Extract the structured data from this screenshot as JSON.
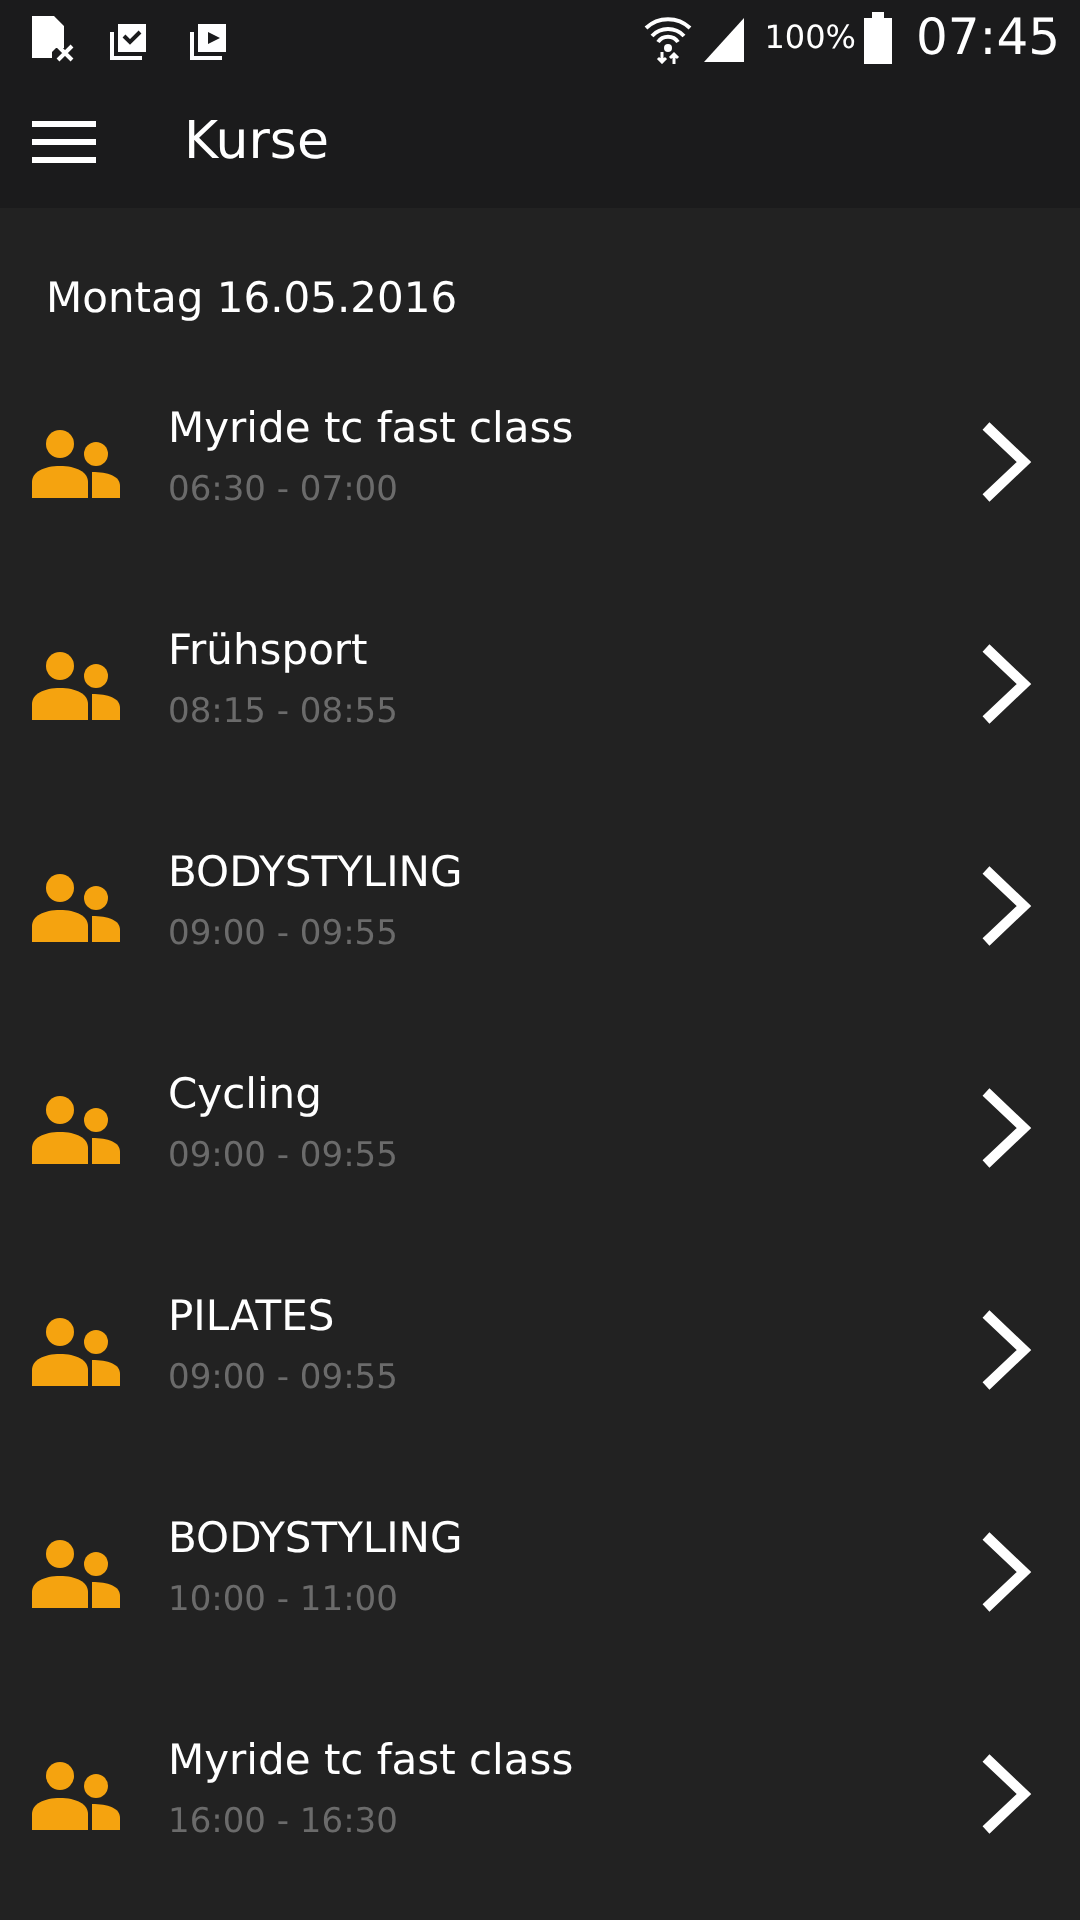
{
  "status_bar": {
    "battery": "100%",
    "time": "07:45"
  },
  "app_bar": {
    "title": "Kurse"
  },
  "date_header": "Montag 16.05.2016",
  "courses": [
    {
      "name": "Myride tc fast class",
      "time": "06:30 - 07:00"
    },
    {
      "name": "Frühsport",
      "time": "08:15 - 08:55"
    },
    {
      "name": "BODYSTYLING",
      "time": "09:00 - 09:55"
    },
    {
      "name": "Cycling",
      "time": "09:00 - 09:55"
    },
    {
      "name": "PILATES",
      "time": "09:00 - 09:55"
    },
    {
      "name": "BODYSTYLING",
      "time": "10:00 - 11:00"
    },
    {
      "name": "Myride tc fast class",
      "time": "16:00 - 16:30"
    }
  ]
}
